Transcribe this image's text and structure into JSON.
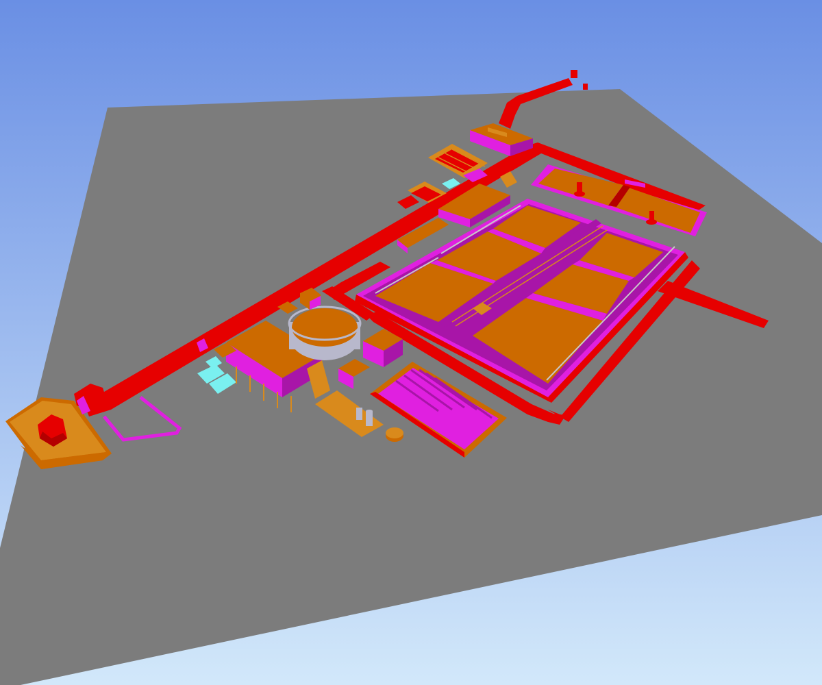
{
  "colors": {
    "sky_top": "#6a8fe4",
    "sky_bottom": "#d2e8fa",
    "ground": "#7c7c7c",
    "road": "#e60000",
    "road_dark": "#b40000",
    "structure": "#e020e0",
    "structure_dark": "#a815a8",
    "basin_fill": "#cc6a00",
    "basin_fill_light": "#e07a10",
    "equipment": "#d98a1c",
    "vehicle": "#7af0f0",
    "tank_metal": "#b8b8cc",
    "railing": "#c8c8c8"
  },
  "icons": [
    "navigation-cube-icon"
  ],
  "scene": {
    "type": "3d-cad-site-model",
    "view": "isometric-perspective"
  }
}
